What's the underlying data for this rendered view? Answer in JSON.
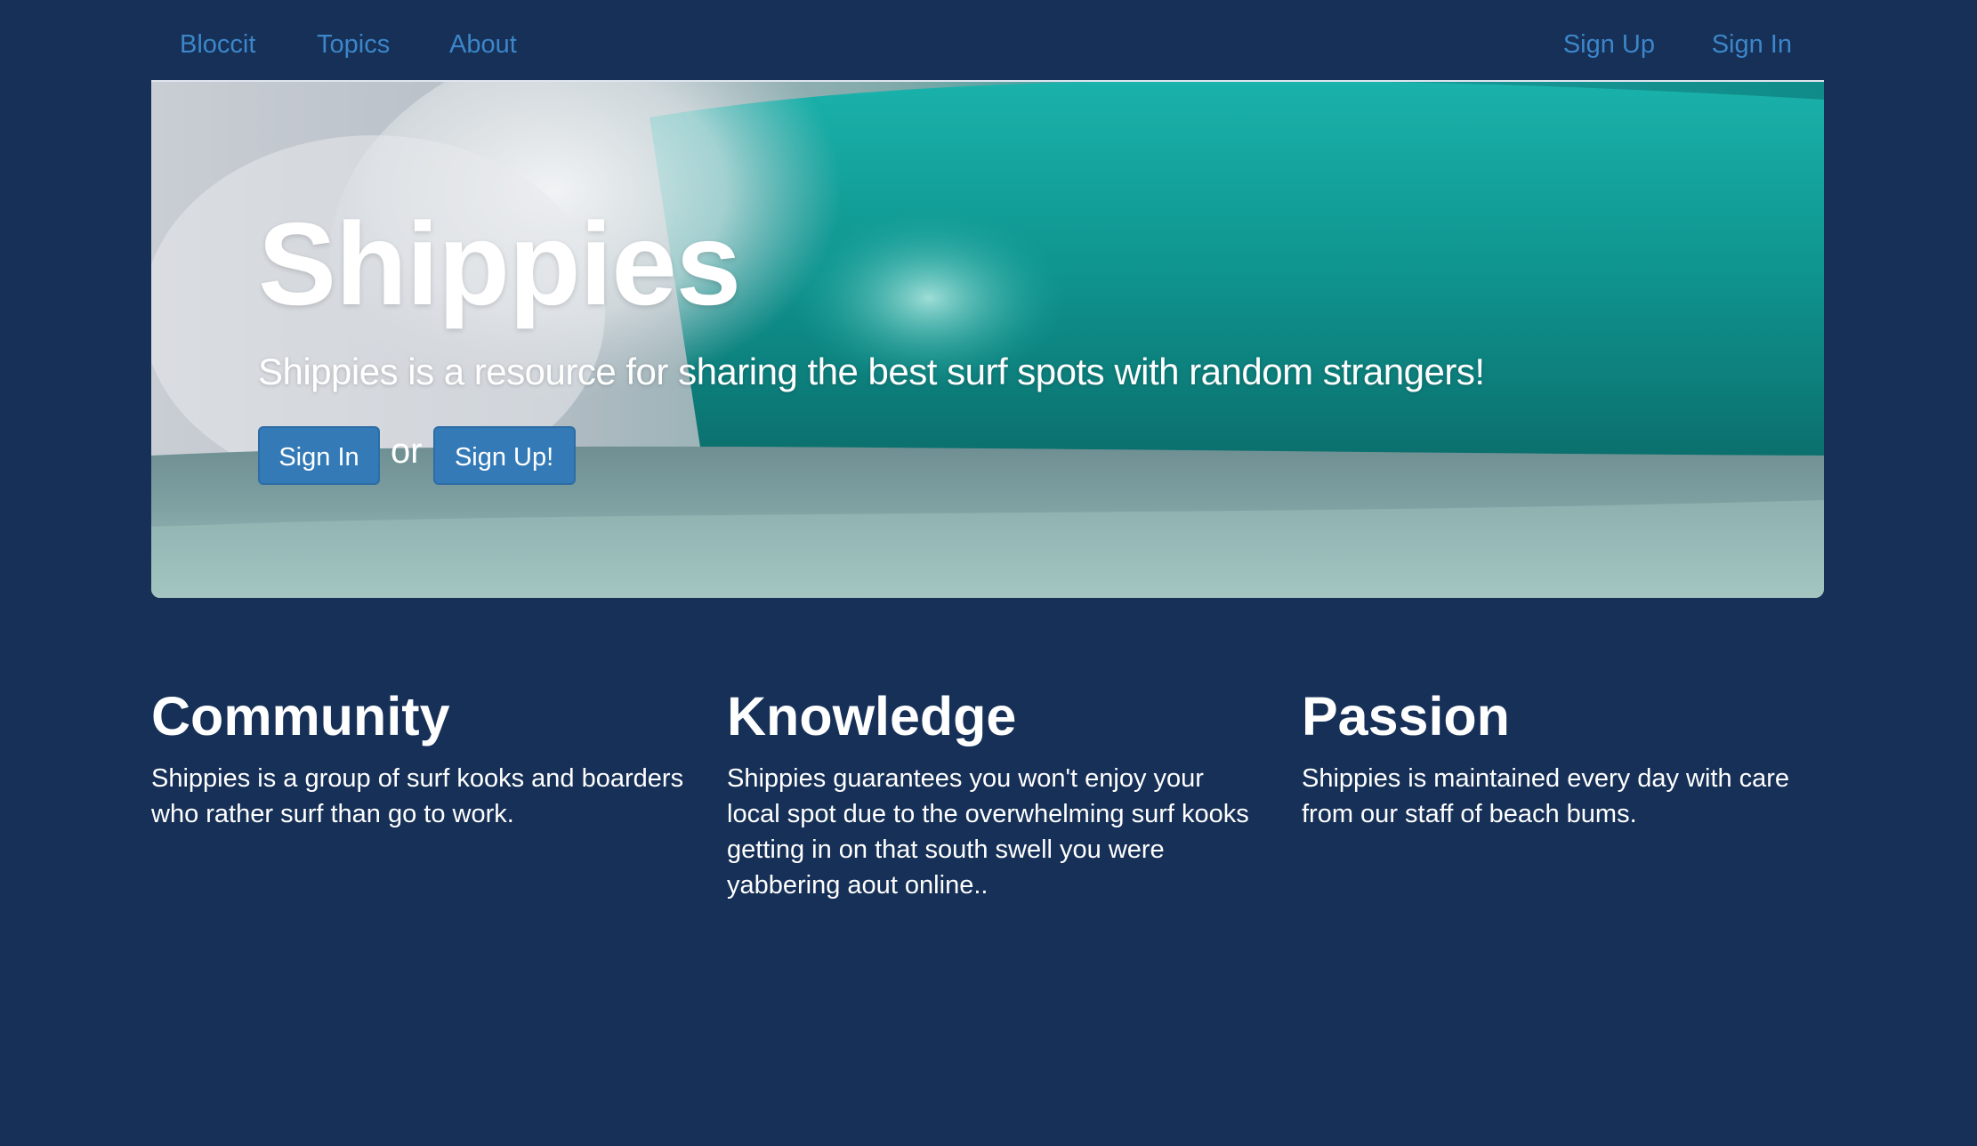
{
  "nav": {
    "brand": "Bloccit",
    "topics": "Topics",
    "about": "About",
    "sign_up": "Sign Up",
    "sign_in": "Sign In"
  },
  "hero": {
    "title": "Shippies",
    "subtitle": "Shippies is a resource for sharing the best surf spots with random strangers!",
    "sign_in_button": "Sign In",
    "or_text": "or",
    "sign_up_button": "Sign Up!"
  },
  "features": [
    {
      "title": "Community",
      "text": "Shippies is a group of surf kooks and boarders who rather surf than go to work."
    },
    {
      "title": "Knowledge",
      "text": "Shippies guarantees you won't enjoy your local spot due to the overwhelming surf kooks getting in on that south swell you were yabbering aout online.."
    },
    {
      "title": "Passion",
      "text": "Shippies is maintained every day with care from our staff of beach bums."
    }
  ],
  "colors": {
    "background": "#163057",
    "link": "#3c86c9",
    "button": "#337ab7",
    "text": "#ffffff"
  }
}
